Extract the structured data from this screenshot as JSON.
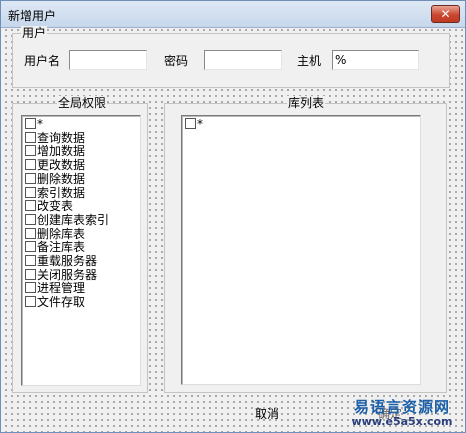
{
  "window": {
    "title": "新增用户",
    "close_label": "✕"
  },
  "user_group": {
    "legend": "用户",
    "username_label": "用户名",
    "username_value": "",
    "password_label": "密码",
    "password_value": "",
    "host_label": "主机",
    "host_value": "%"
  },
  "global_perms": {
    "legend": "全局权限",
    "items": [
      {
        "label": "*",
        "checked": false
      },
      {
        "label": "查询数据",
        "checked": false
      },
      {
        "label": "增加数据",
        "checked": false
      },
      {
        "label": "更改数据",
        "checked": false
      },
      {
        "label": "删除数据",
        "checked": false
      },
      {
        "label": "索引数据",
        "checked": false
      },
      {
        "label": "改变表",
        "checked": false
      },
      {
        "label": "创建库表索引",
        "checked": false
      },
      {
        "label": "删除库表",
        "checked": false
      },
      {
        "label": "备注库表",
        "checked": false
      },
      {
        "label": "重载服务器",
        "checked": false
      },
      {
        "label": "关闭服务器",
        "checked": false
      },
      {
        "label": "进程管理",
        "checked": false
      },
      {
        "label": "文件存取",
        "checked": false
      }
    ]
  },
  "db_list": {
    "legend": "库列表",
    "items": [
      {
        "label": "*",
        "checked": false
      }
    ]
  },
  "buttons": {
    "ok_label": "确定",
    "cancel_label": "取消"
  },
  "watermark": {
    "text": "易语言资源网",
    "url": "www.e5a5x.com"
  }
}
